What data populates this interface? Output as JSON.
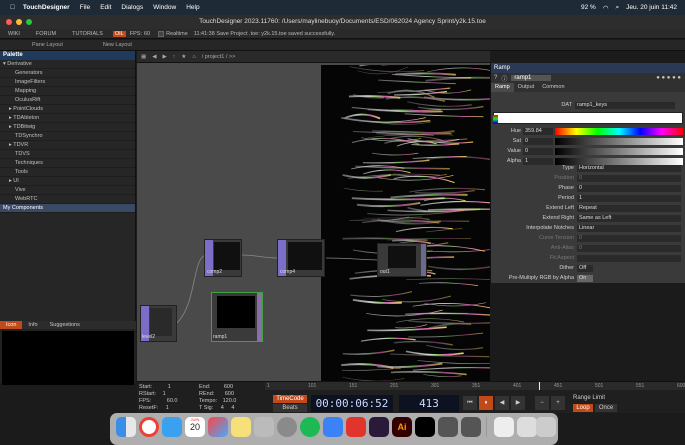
{
  "mac_menu": {
    "app": "TouchDesigner",
    "items": [
      "File",
      "Edit",
      "Dialogs",
      "Window",
      "Help"
    ],
    "battery": "92 %",
    "datetime": "Jeu. 20 juin 11:42"
  },
  "window": {
    "title": "TouchDesigner 2023.11760: /Users/maylinebuoy/Documents/ESD/062024 Agency Sprint/y2k.15.toe"
  },
  "menubar": {
    "items": [
      "WIKI",
      "FORUM",
      "TUTORIALS"
    ],
    "fps_label": "FPS:",
    "fps": "60",
    "realtime": "Realtime",
    "status": "11:41:38 Save Project .toe: y2k.15.toe saved successfully.",
    "oil": "OIL"
  },
  "toolbar2": {
    "pane_layout": "Pane Layout",
    "new_layout": "New Layout"
  },
  "palette": {
    "title": "Palette",
    "items": [
      {
        "label": "Derivative",
        "indent": 0,
        "arrow": "▾"
      },
      {
        "label": "Generators",
        "indent": 2,
        "arrow": ""
      },
      {
        "label": "ImageFilters",
        "indent": 2,
        "arrow": ""
      },
      {
        "label": "Mapping",
        "indent": 2,
        "arrow": ""
      },
      {
        "label": "OculusRift",
        "indent": 2,
        "arrow": ""
      },
      {
        "label": "PointClouds",
        "indent": 1,
        "arrow": "▸"
      },
      {
        "label": "TDAbleton",
        "indent": 1,
        "arrow": "▸"
      },
      {
        "label": "TDBitwig",
        "indent": 1,
        "arrow": "▸"
      },
      {
        "label": "TDSynchro",
        "indent": 2,
        "arrow": ""
      },
      {
        "label": "TDVR",
        "indent": 1,
        "arrow": "▸"
      },
      {
        "label": "TDVS",
        "indent": 2,
        "arrow": ""
      },
      {
        "label": "Techniques",
        "indent": 2,
        "arrow": ""
      },
      {
        "label": "Tools",
        "indent": 2,
        "arrow": ""
      },
      {
        "label": "UI",
        "indent": 1,
        "arrow": "▸"
      },
      {
        "label": "Vive",
        "indent": 2,
        "arrow": ""
      },
      {
        "label": "WebRTC",
        "indent": 2,
        "arrow": ""
      },
      {
        "label": "My Components",
        "indent": 0,
        "arrow": "",
        "selected": true
      }
    ]
  },
  "help_tabs": [
    "Icon",
    "Info",
    "Suggestions"
  ],
  "network": {
    "path": "/ project1 / >>"
  },
  "nodes": [
    {
      "name": "comp2"
    },
    {
      "name": "comp4"
    },
    {
      "name": "out1"
    },
    {
      "name": "ramp1"
    },
    {
      "name": "level2"
    }
  ],
  "params": {
    "header": "Ramp",
    "node_name": "ramp1",
    "tabs": [
      "Ramp",
      "Output",
      "Common"
    ],
    "dat": {
      "label": "DAT",
      "value": "ramp1_keys"
    },
    "hsv": [
      {
        "label": "Hue",
        "value": "359.84"
      },
      {
        "label": "Sat",
        "value": "0"
      },
      {
        "label": "Value",
        "value": "0"
      },
      {
        "label": "Alpha",
        "value": "1"
      }
    ],
    "rows": [
      {
        "label": "Type",
        "value": "Horizontal",
        "dim": false
      },
      {
        "label": "Position",
        "value": "0",
        "dim": true
      },
      {
        "label": "Phase",
        "value": "0",
        "dim": false
      },
      {
        "label": "Period",
        "value": "1",
        "dim": false
      },
      {
        "label": "Extend Left",
        "value": "Repeat",
        "dim": false
      },
      {
        "label": "Extend Right",
        "value": "Same as Left",
        "dim": false
      },
      {
        "label": "Interpolate Notches",
        "value": "Linear",
        "dim": false
      },
      {
        "label": "Curve Tension",
        "value": "0",
        "dim": true
      },
      {
        "label": "Anti-Alias",
        "value": "0",
        "dim": true
      },
      {
        "label": "Fit Aspect",
        "value": "",
        "dim": true
      },
      {
        "label": "Dither",
        "value": "Off",
        "dim": false
      },
      {
        "label": "Pre-Multiply RGB by Alpha",
        "value": "On",
        "dim": false
      }
    ]
  },
  "timeline": {
    "start": "1",
    "end": "600",
    "rstart": "1",
    "rend": "600",
    "fps": "60.0",
    "tempo": "120.0",
    "resetf": "1",
    "tsig1": "4",
    "tsig2": "4",
    "labels": {
      "start": "Start:",
      "end": "End:",
      "rstart": "RStart:",
      "rend": "REnd:",
      "fps": "FPS:",
      "tempo": "Tempo:",
      "resetf": "ResetF:",
      "tsig": "T Sig:"
    },
    "ruler": [
      "1",
      "101",
      "151",
      "201",
      "301",
      "351",
      "401",
      "451",
      "501",
      "551",
      "600"
    ],
    "timecode_label": "TimeCode",
    "beats_label": "Beats",
    "timecode": "00:00:06:52",
    "frame": "413",
    "range_limit": "Range Limit",
    "loop": "Loop",
    "once": "Once"
  },
  "dock": {
    "calendar_month": "JUIN",
    "calendar_day": "20"
  }
}
